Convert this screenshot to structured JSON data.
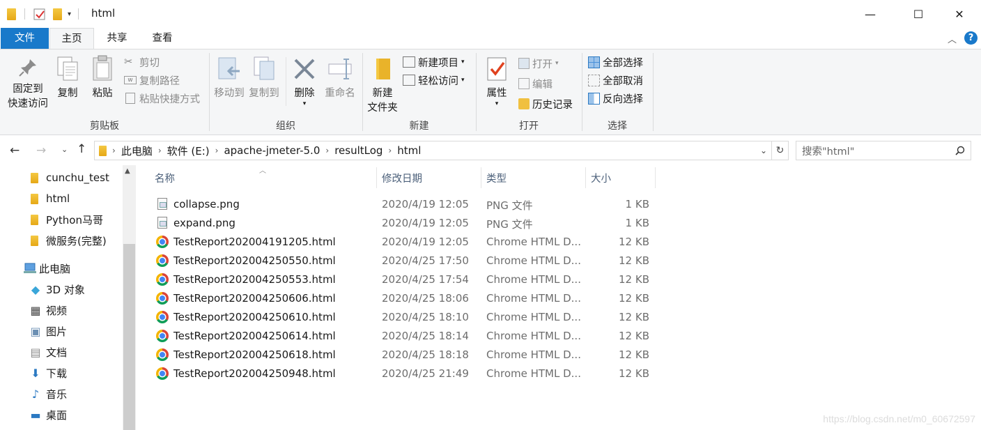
{
  "window": {
    "title": "html",
    "minimize": "—",
    "maximize": "☐",
    "close": "✕"
  },
  "tabs": {
    "file": "文件",
    "home": "主页",
    "share": "共享",
    "view": "查看"
  },
  "ribbon": {
    "clipboard": {
      "pin_line1": "固定到",
      "pin_line2": "快速访问",
      "copy": "复制",
      "paste": "粘贴",
      "cut": "剪切",
      "copy_path": "复制路径",
      "paste_shortcut": "粘贴快捷方式",
      "label": "剪贴板"
    },
    "organize": {
      "move_to": "移动到",
      "copy_to": "复制到",
      "delete": "删除",
      "rename": "重命名",
      "label": "组织"
    },
    "new": {
      "new_folder_line1": "新建",
      "new_folder_line2": "文件夹",
      "new_item": "新建项目",
      "easy_access": "轻松访问",
      "label": "新建"
    },
    "open": {
      "properties": "属性",
      "open": "打开",
      "edit": "编辑",
      "history": "历史记录",
      "label": "打开"
    },
    "select": {
      "select_all": "全部选择",
      "select_none": "全部取消",
      "invert": "反向选择",
      "label": "选择"
    }
  },
  "address": {
    "crumbs": [
      "此电脑",
      "软件 (E:)",
      "apache-jmeter-5.0",
      "resultLog",
      "html"
    ],
    "search_placeholder": "搜索\"html\""
  },
  "nav": {
    "folders": [
      "cunchu_test",
      "html",
      "Python马哥",
      "微服务(完整)"
    ],
    "this_pc": "此电脑",
    "pc_items": [
      {
        "label": "3D 对象",
        "icon": "3d-objects-icon"
      },
      {
        "label": "视频",
        "icon": "video-icon"
      },
      {
        "label": "图片",
        "icon": "pictures-icon"
      },
      {
        "label": "文档",
        "icon": "documents-icon"
      },
      {
        "label": "下载",
        "icon": "downloads-icon"
      },
      {
        "label": "音乐",
        "icon": "music-icon"
      },
      {
        "label": "桌面",
        "icon": "desktop-icon"
      }
    ]
  },
  "columns": {
    "name": "名称",
    "date": "修改日期",
    "type": "类型",
    "size": "大小"
  },
  "files": [
    {
      "name": "collapse.png",
      "date": "2020/4/19 12:05",
      "type": "PNG 文件",
      "size": "1 KB",
      "icon": "png"
    },
    {
      "name": "expand.png",
      "date": "2020/4/19 12:05",
      "type": "PNG 文件",
      "size": "1 KB",
      "icon": "png"
    },
    {
      "name": "TestReport202004191205.html",
      "date": "2020/4/19 12:05",
      "type": "Chrome HTML D...",
      "size": "12 KB",
      "icon": "chrome"
    },
    {
      "name": "TestReport202004250550.html",
      "date": "2020/4/25 17:50",
      "type": "Chrome HTML D...",
      "size": "12 KB",
      "icon": "chrome"
    },
    {
      "name": "TestReport202004250553.html",
      "date": "2020/4/25 17:54",
      "type": "Chrome HTML D...",
      "size": "12 KB",
      "icon": "chrome"
    },
    {
      "name": "TestReport202004250606.html",
      "date": "2020/4/25 18:06",
      "type": "Chrome HTML D...",
      "size": "12 KB",
      "icon": "chrome"
    },
    {
      "name": "TestReport202004250610.html",
      "date": "2020/4/25 18:10",
      "type": "Chrome HTML D...",
      "size": "12 KB",
      "icon": "chrome"
    },
    {
      "name": "TestReport202004250614.html",
      "date": "2020/4/25 18:14",
      "type": "Chrome HTML D...",
      "size": "12 KB",
      "icon": "chrome"
    },
    {
      "name": "TestReport202004250618.html",
      "date": "2020/4/25 18:18",
      "type": "Chrome HTML D...",
      "size": "12 KB",
      "icon": "chrome"
    },
    {
      "name": "TestReport202004250948.html",
      "date": "2020/4/25 21:49",
      "type": "Chrome HTML D...",
      "size": "12 KB",
      "icon": "chrome"
    }
  ],
  "watermark": "https://blog.csdn.net/m0_60672597",
  "colors": {
    "accent": "#1979ca",
    "ribbon_bg": "#f5f6f7",
    "header_text": "#4c607a"
  }
}
